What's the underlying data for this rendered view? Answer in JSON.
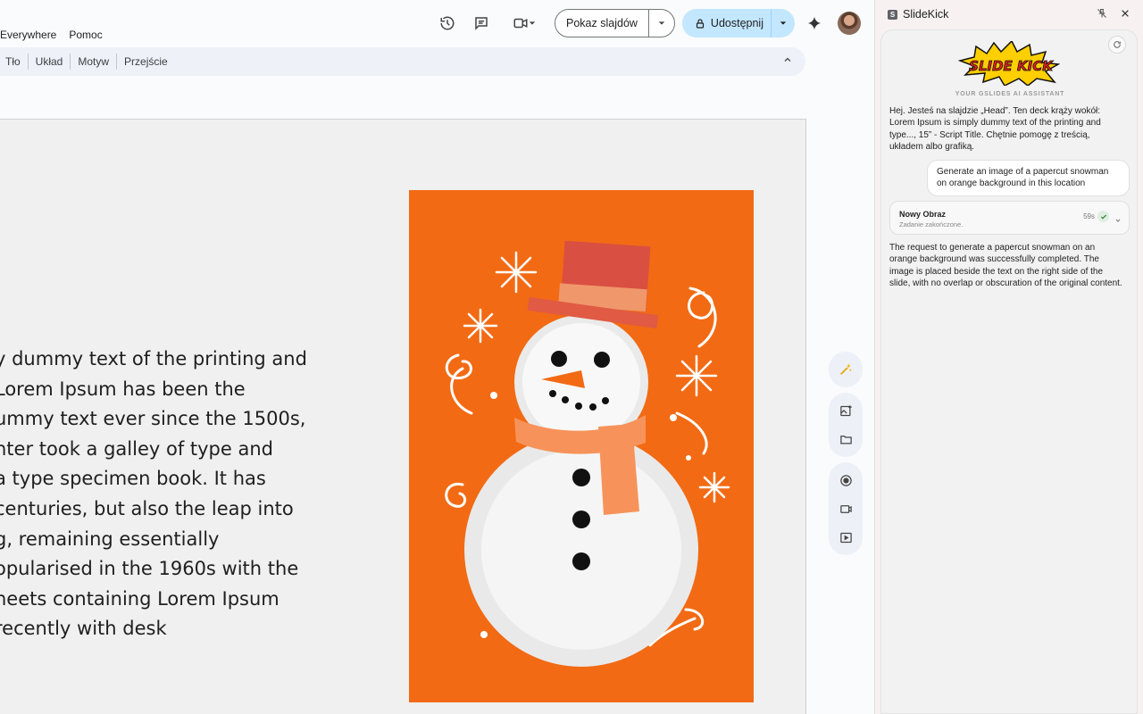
{
  "menubar": {
    "items": [
      "Everywhere",
      "Pomoc"
    ]
  },
  "header": {
    "slideshow_label": "Pokaz slajdów",
    "share_label": "Udostępnij"
  },
  "toolbar": {
    "items": [
      "Tło",
      "Układ",
      "Motyw",
      "Przejście"
    ]
  },
  "slide": {
    "text_lines": [
      "y dummy text of the printing and",
      "Lorem Ipsum has been the",
      "ummy text ever since the 1500s,",
      "nter took a galley of type and",
      " a type specimen book. It has",
      " centuries, but also the leap into",
      "g, remaining essentially",
      "opularised in the 1960s with the",
      "heets containing Lorem Ipsum",
      "recently with desk"
    ]
  },
  "panel": {
    "title": "SlideKick",
    "brand": "SLIDE KICK",
    "tagline": "YOUR GSLIDES AI ASSISTANT",
    "assistant_msg": "Hej. Jesteś na slajdzie „Head”. Ten deck krąży wokół: Lorem Ipsum is simply dummy text of the printing and type..., 15” - Script Title. Chętnie pomogę z treścią, układem albo grafiką.",
    "user_msg": "Generate an image of a papercut snowman on orange background in this location",
    "task": {
      "title": "Nowy Obraz",
      "status": "Zadanie zakończone.",
      "time": "59s"
    },
    "result_msg": "The request to generate a papercut snowman on an orange background was successfully completed. The image is placed beside the text on the right side of the slide, with no overlap or obscuration of the original content."
  },
  "colors": {
    "accent": "#c2e7ff",
    "image_bg": "#f26a14",
    "brand_red": "#e2231a",
    "brand_yellow": "#ffd400"
  },
  "icons": [
    "history-icon",
    "comment-icon",
    "video-icon",
    "lock-icon",
    "gemini-icon",
    "avatar",
    "pin-off-icon",
    "close-icon",
    "refresh-icon",
    "magic-icon",
    "add-image-icon",
    "folder-icon",
    "record-icon",
    "camera-icon",
    "play-icon"
  ]
}
